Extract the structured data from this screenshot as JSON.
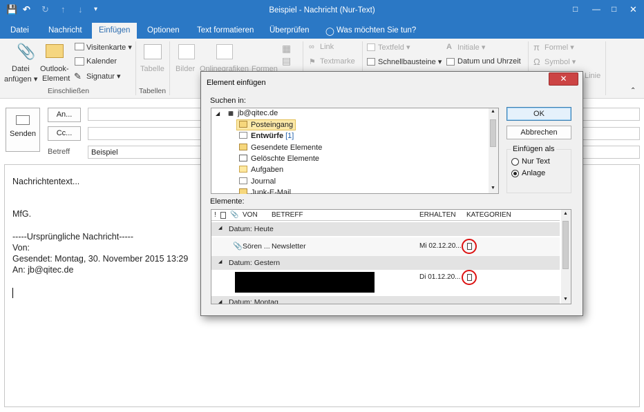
{
  "window": {
    "title": "Beispiel - Nachricht (Nur-Text)",
    "quick_access": [
      "save-icon",
      "undo-icon",
      "redo-icon",
      "up-icon",
      "down-icon",
      "customize-icon"
    ],
    "controls": [
      "help-icon",
      "minimize-icon",
      "maximize-icon",
      "close-icon"
    ]
  },
  "tabs": [
    "Datei",
    "Nachricht",
    "Einfügen",
    "Optionen",
    "Text formatieren",
    "Überprüfen"
  ],
  "tell_me": "Was möchten Sie tun?",
  "ribbon": {
    "datei": "Datei",
    "anfuegen": "anfügen",
    "outlook": "Outlook-",
    "element": "Element",
    "visitenkarte": "Visitenkarte",
    "kalender": "Kalender",
    "signatur": "Signatur",
    "einschliessen": "Einschließen",
    "tabelle": "Tabelle",
    "tabellen": "Tabellen",
    "bilder": "Bilder",
    "onlinegrafiken": "Onlinegrafiken",
    "formen": "Formen",
    "link": "Link",
    "textmarke": "Textmarke",
    "textfeld": "Textfeld",
    "schnellbausteine": "Schnellbausteine",
    "initiale": "Initiale",
    "datum_uhrzeit": "Datum und Uhrzeit",
    "formel": "Formel",
    "symbol": "Symbol",
    "linie": "Linie"
  },
  "compose": {
    "an": "An...",
    "cc": "Cc...",
    "betreff_label": "Betreff",
    "betreff_value": "Beispiel",
    "senden": "Senden"
  },
  "body": {
    "lines": [
      "Nachrichtentext...",
      "MfG.",
      "-----Ursprüngliche Nachricht-----",
      "Von:",
      "Gesendet: Montag, 30. November 2015 13:29",
      "An: jb@qitec.de"
    ]
  },
  "dialog": {
    "title": "Element einfügen",
    "close": "✕",
    "suchen_in": "Suchen in:",
    "account": "jb@qitec.de",
    "folders": [
      "Posteingang",
      "Entwürfe",
      "Gesendete Elemente",
      "Gelöschte Elemente",
      "Aufgaben",
      "Journal",
      "Junk-E-Mail"
    ],
    "drafts_count": "[1]",
    "ok": "OK",
    "abbrechen": "Abbrechen",
    "einfuegen_als": "Einfügen als",
    "option_text": "Nur Text",
    "option_anlage": "Anlage",
    "elemente": "Elemente:",
    "columns": {
      "flag": "!",
      "type": "",
      "attach": "",
      "von": "VON",
      "betreff": "BETREFF",
      "erhalten": "ERHALTEN",
      "kategorien": "KATEGORIEN"
    },
    "groups": [
      "Datum: Heute",
      "Datum: Gestern",
      "Datum: Montag"
    ],
    "rows": [
      {
        "von": "Sören ...",
        "betreff": "Newsletter",
        "erhalten": "Mi 02.12.20..."
      },
      {
        "von": "",
        "betreff": "",
        "erhalten": "Di 01.12.20..."
      }
    ]
  }
}
